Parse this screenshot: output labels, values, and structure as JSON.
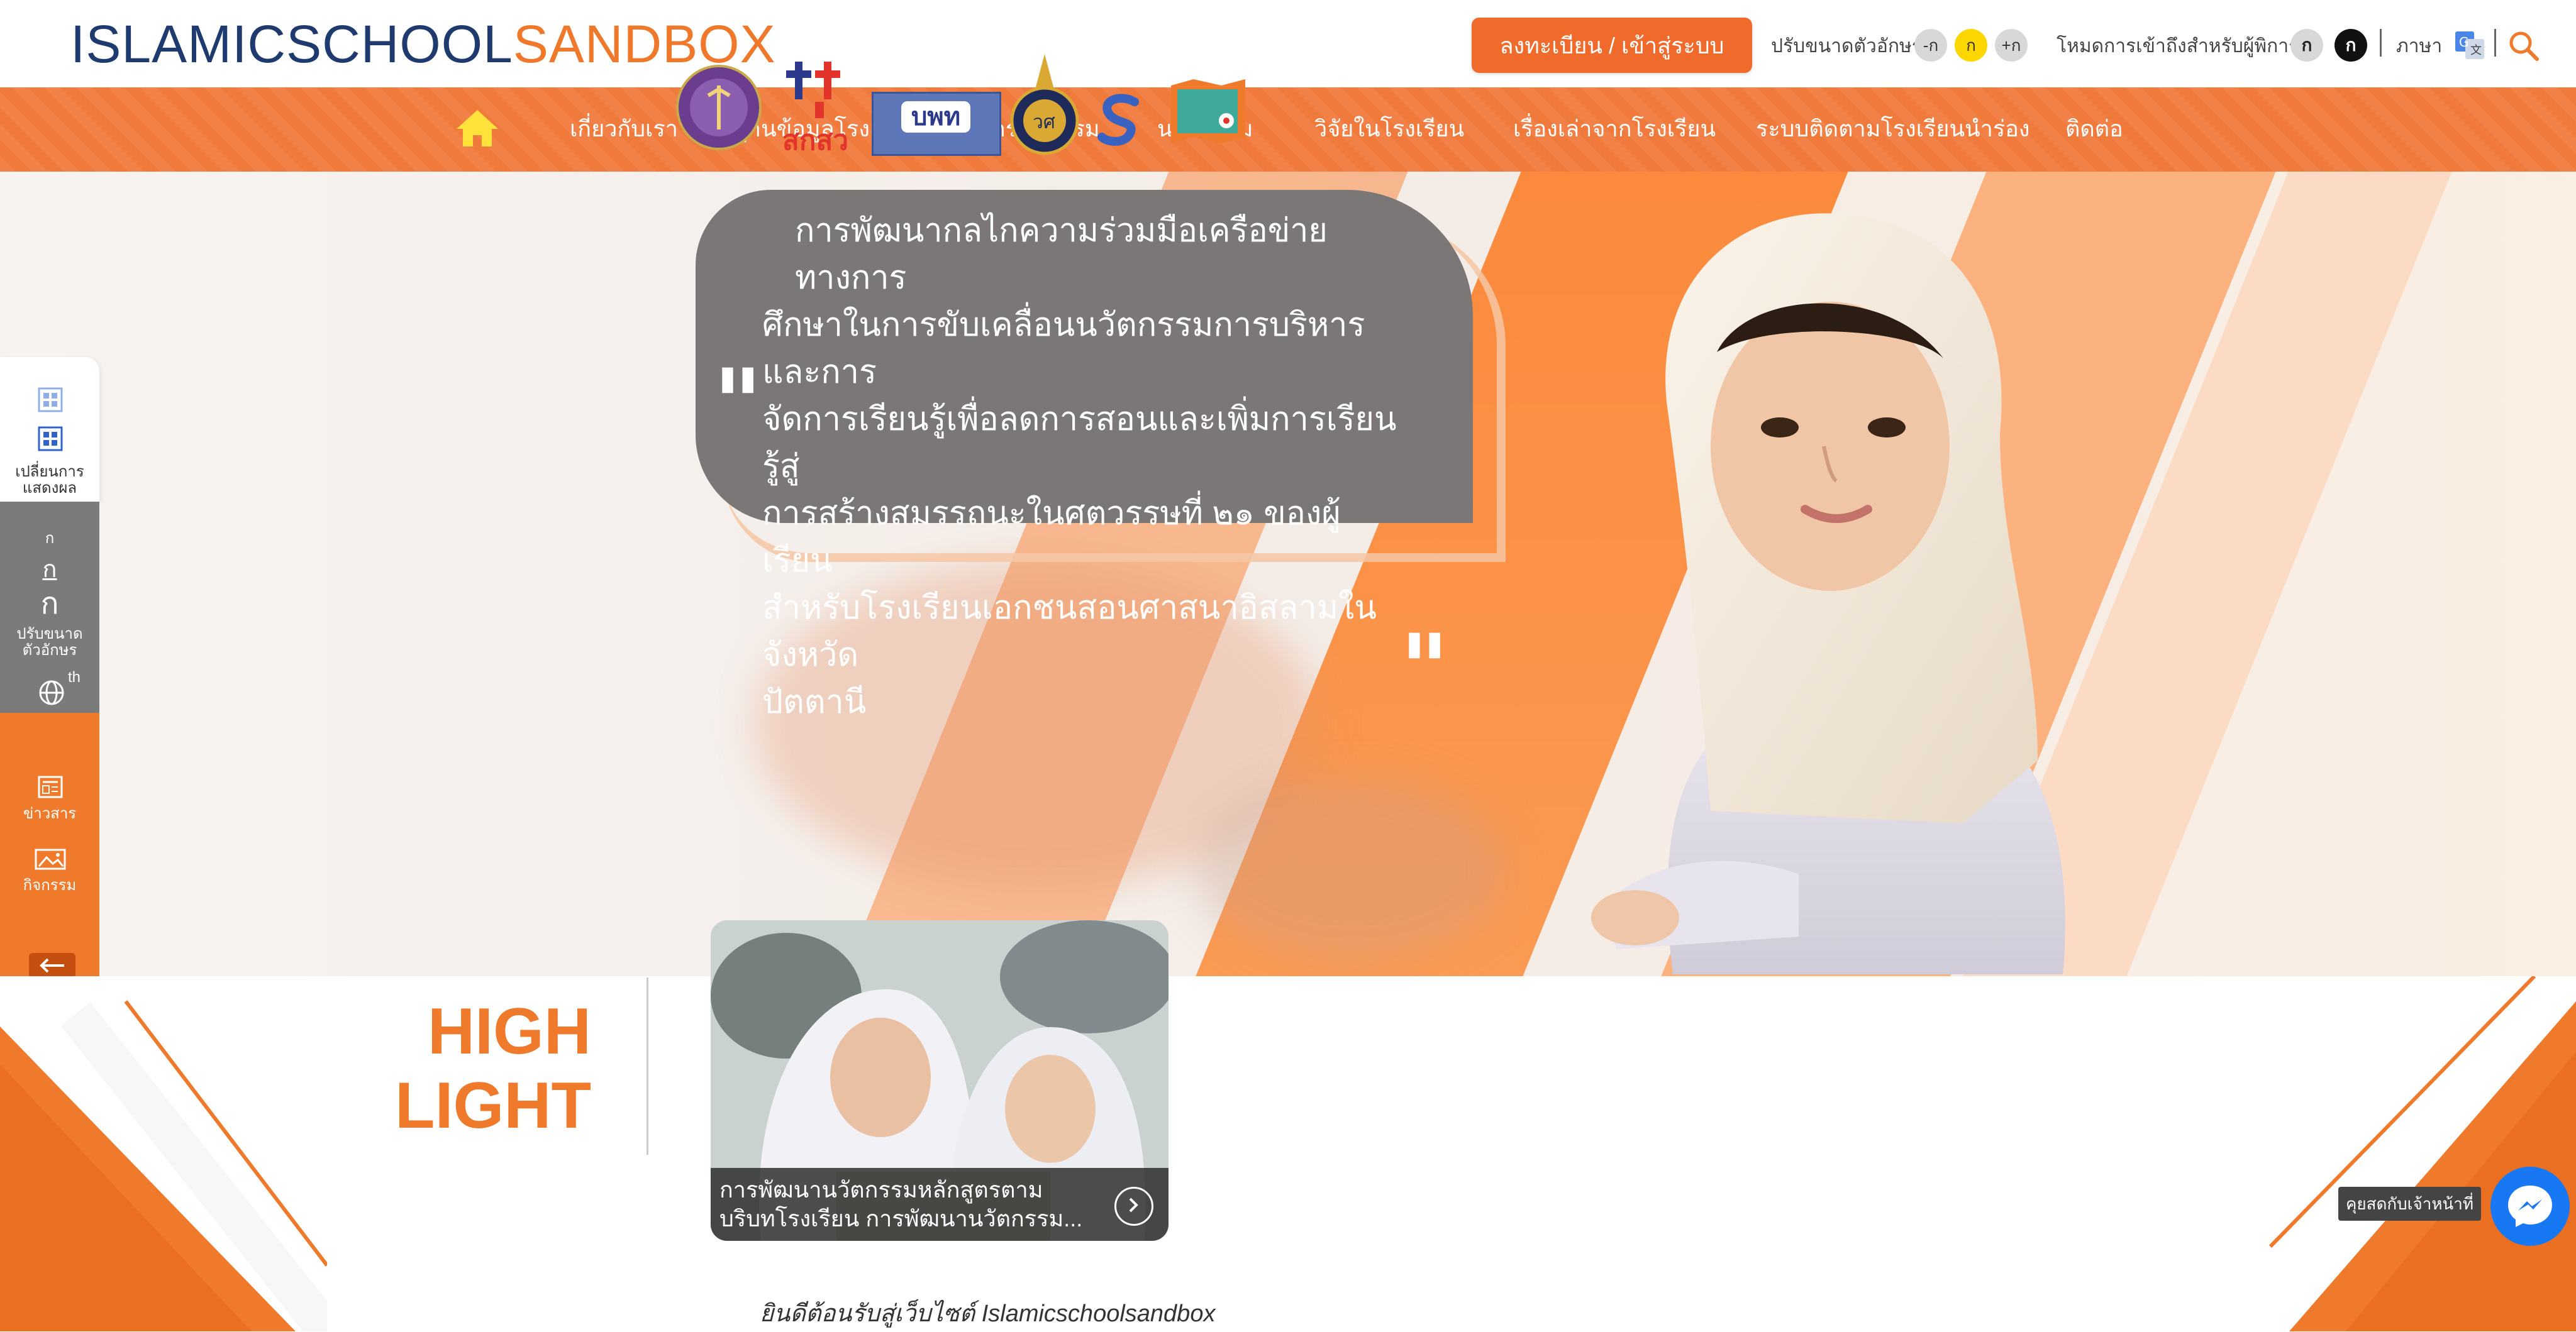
{
  "header": {
    "logo_part1": "ISLAMICSCHOOL",
    "logo_part2": "SANDBOX",
    "register_button": "ลงทะเบียน / เข้าสู่ระบบ",
    "font_size_label": "ปรับขนาดตัวอักษร",
    "font_size_options": [
      "-ก",
      "ก",
      "+ก"
    ],
    "accessibility_label": "โหมดการเข้าถึงสำหรับผู้พิการ",
    "accessibility_options": [
      "ก",
      "ก"
    ],
    "language_label": "ภาษา"
  },
  "nav": {
    "items": [
      "เกี่ยวกับเรา",
      "ฐานข้อมูลโรงเรียน",
      "กิจกรรมอบรม",
      "นวัตกรรม",
      "วิจัยในโรงเรียน",
      "เรื่องเล่าจากโรงเรียน",
      "ระบบติดตามโรงเรียนนำร่อง",
      "ติดต่อ"
    ]
  },
  "hero": {
    "partner_logos": [
      "สกสว",
      "บพท"
    ],
    "quote_lines": [
      "การพัฒนากลไกความร่วมมือเครือข่ายทางการ",
      "ศึกษาในการขับเคลื่อนนวัตกรรมการบริหารและการ",
      "จัดการเรียนรู้เพื่อลดการสอนและเพิ่มการเรียนรู้สู่",
      "การสร้างสมรรถนะในศตวรรษที่ ๒๑ ของผู้เรียน",
      "สำหรับโรงเรียนเอกชนสอนศาสนาอิสลามในจังหวัด",
      "ปัตตานี"
    ]
  },
  "sidepanel": {
    "display_label_1": "เปลี่ยนการ",
    "display_label_2": "แสดงผล",
    "font_small": "ก",
    "font_medium": "ก",
    "font_large": "ก",
    "font_label_1": "ปรับขนาด",
    "font_label_2": "ตัวอักษร",
    "lang_code": "th",
    "news_label": "ข่าวสาร",
    "activity_label": "กิจกรรม"
  },
  "highlight": {
    "title_line1": "HIGH",
    "title_line2": "LIGHT",
    "card_line1": "การพัฒนานวัตกรรมหลักสูตรตาม",
    "card_line2": "บริบทโรงเรียน การพัฒนานวัตกรรม..."
  },
  "footer": {
    "welcome": "ยินดีต้อนรับสู่เว็บไซต์ Islamicschoolsandbox",
    "chat_label": "คุยสดกับเจ้าหน้าที่"
  },
  "colors": {
    "accent": "#f07a2c",
    "brand_blue": "#1f3a6e",
    "quote_bg": "#7b7776",
    "messenger": "#1877f2"
  }
}
